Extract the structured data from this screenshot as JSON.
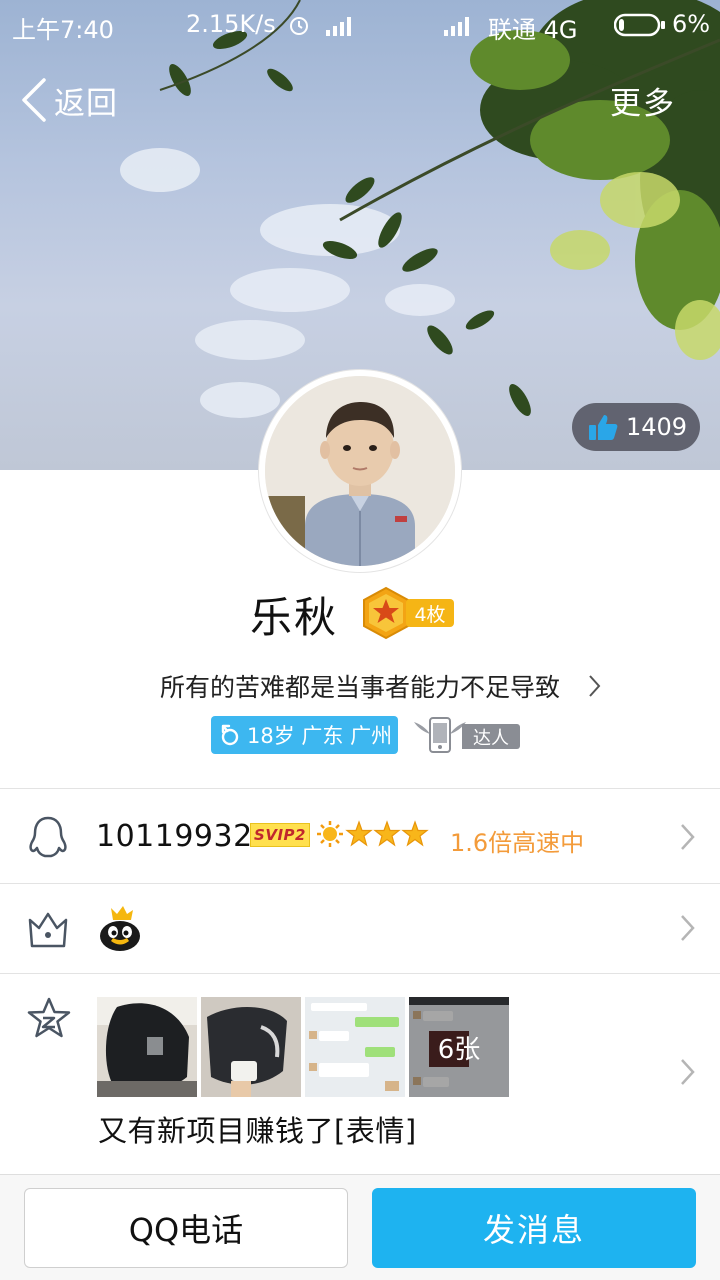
{
  "status_bar": {
    "time": "上午7:40",
    "net_speed": "2.15K/s",
    "carrier": "联通 4G",
    "battery": "6%",
    "icons": [
      "alarm-icon",
      "signal-icon",
      "signal-icon",
      "battery-icon"
    ]
  },
  "nav": {
    "back_label": "返回",
    "more_label": "更多"
  },
  "likes": {
    "count": "1409",
    "icon": "thumbs-up-icon"
  },
  "profile": {
    "name": "乐秋",
    "medal_count": "4枚",
    "signature": "所有的苦难都是当事者能力不足导致",
    "info_tag": "18岁 广东 广州",
    "expert_label": "达人"
  },
  "rows": {
    "qq": {
      "number": "10119932",
      "svip": "SVIP2",
      "speed": "1.6倍高速中"
    },
    "space": {
      "last_photo_count": "6张",
      "post_text": "又有新项目赚钱了[表情]"
    }
  },
  "actions": {
    "call_label": "QQ电话",
    "message_label": "发消息"
  },
  "colors": {
    "accent": "#1eb3f0",
    "info_tag": "#3db7f0",
    "speed_text": "#f39b3a",
    "medal": "#f5b515"
  }
}
